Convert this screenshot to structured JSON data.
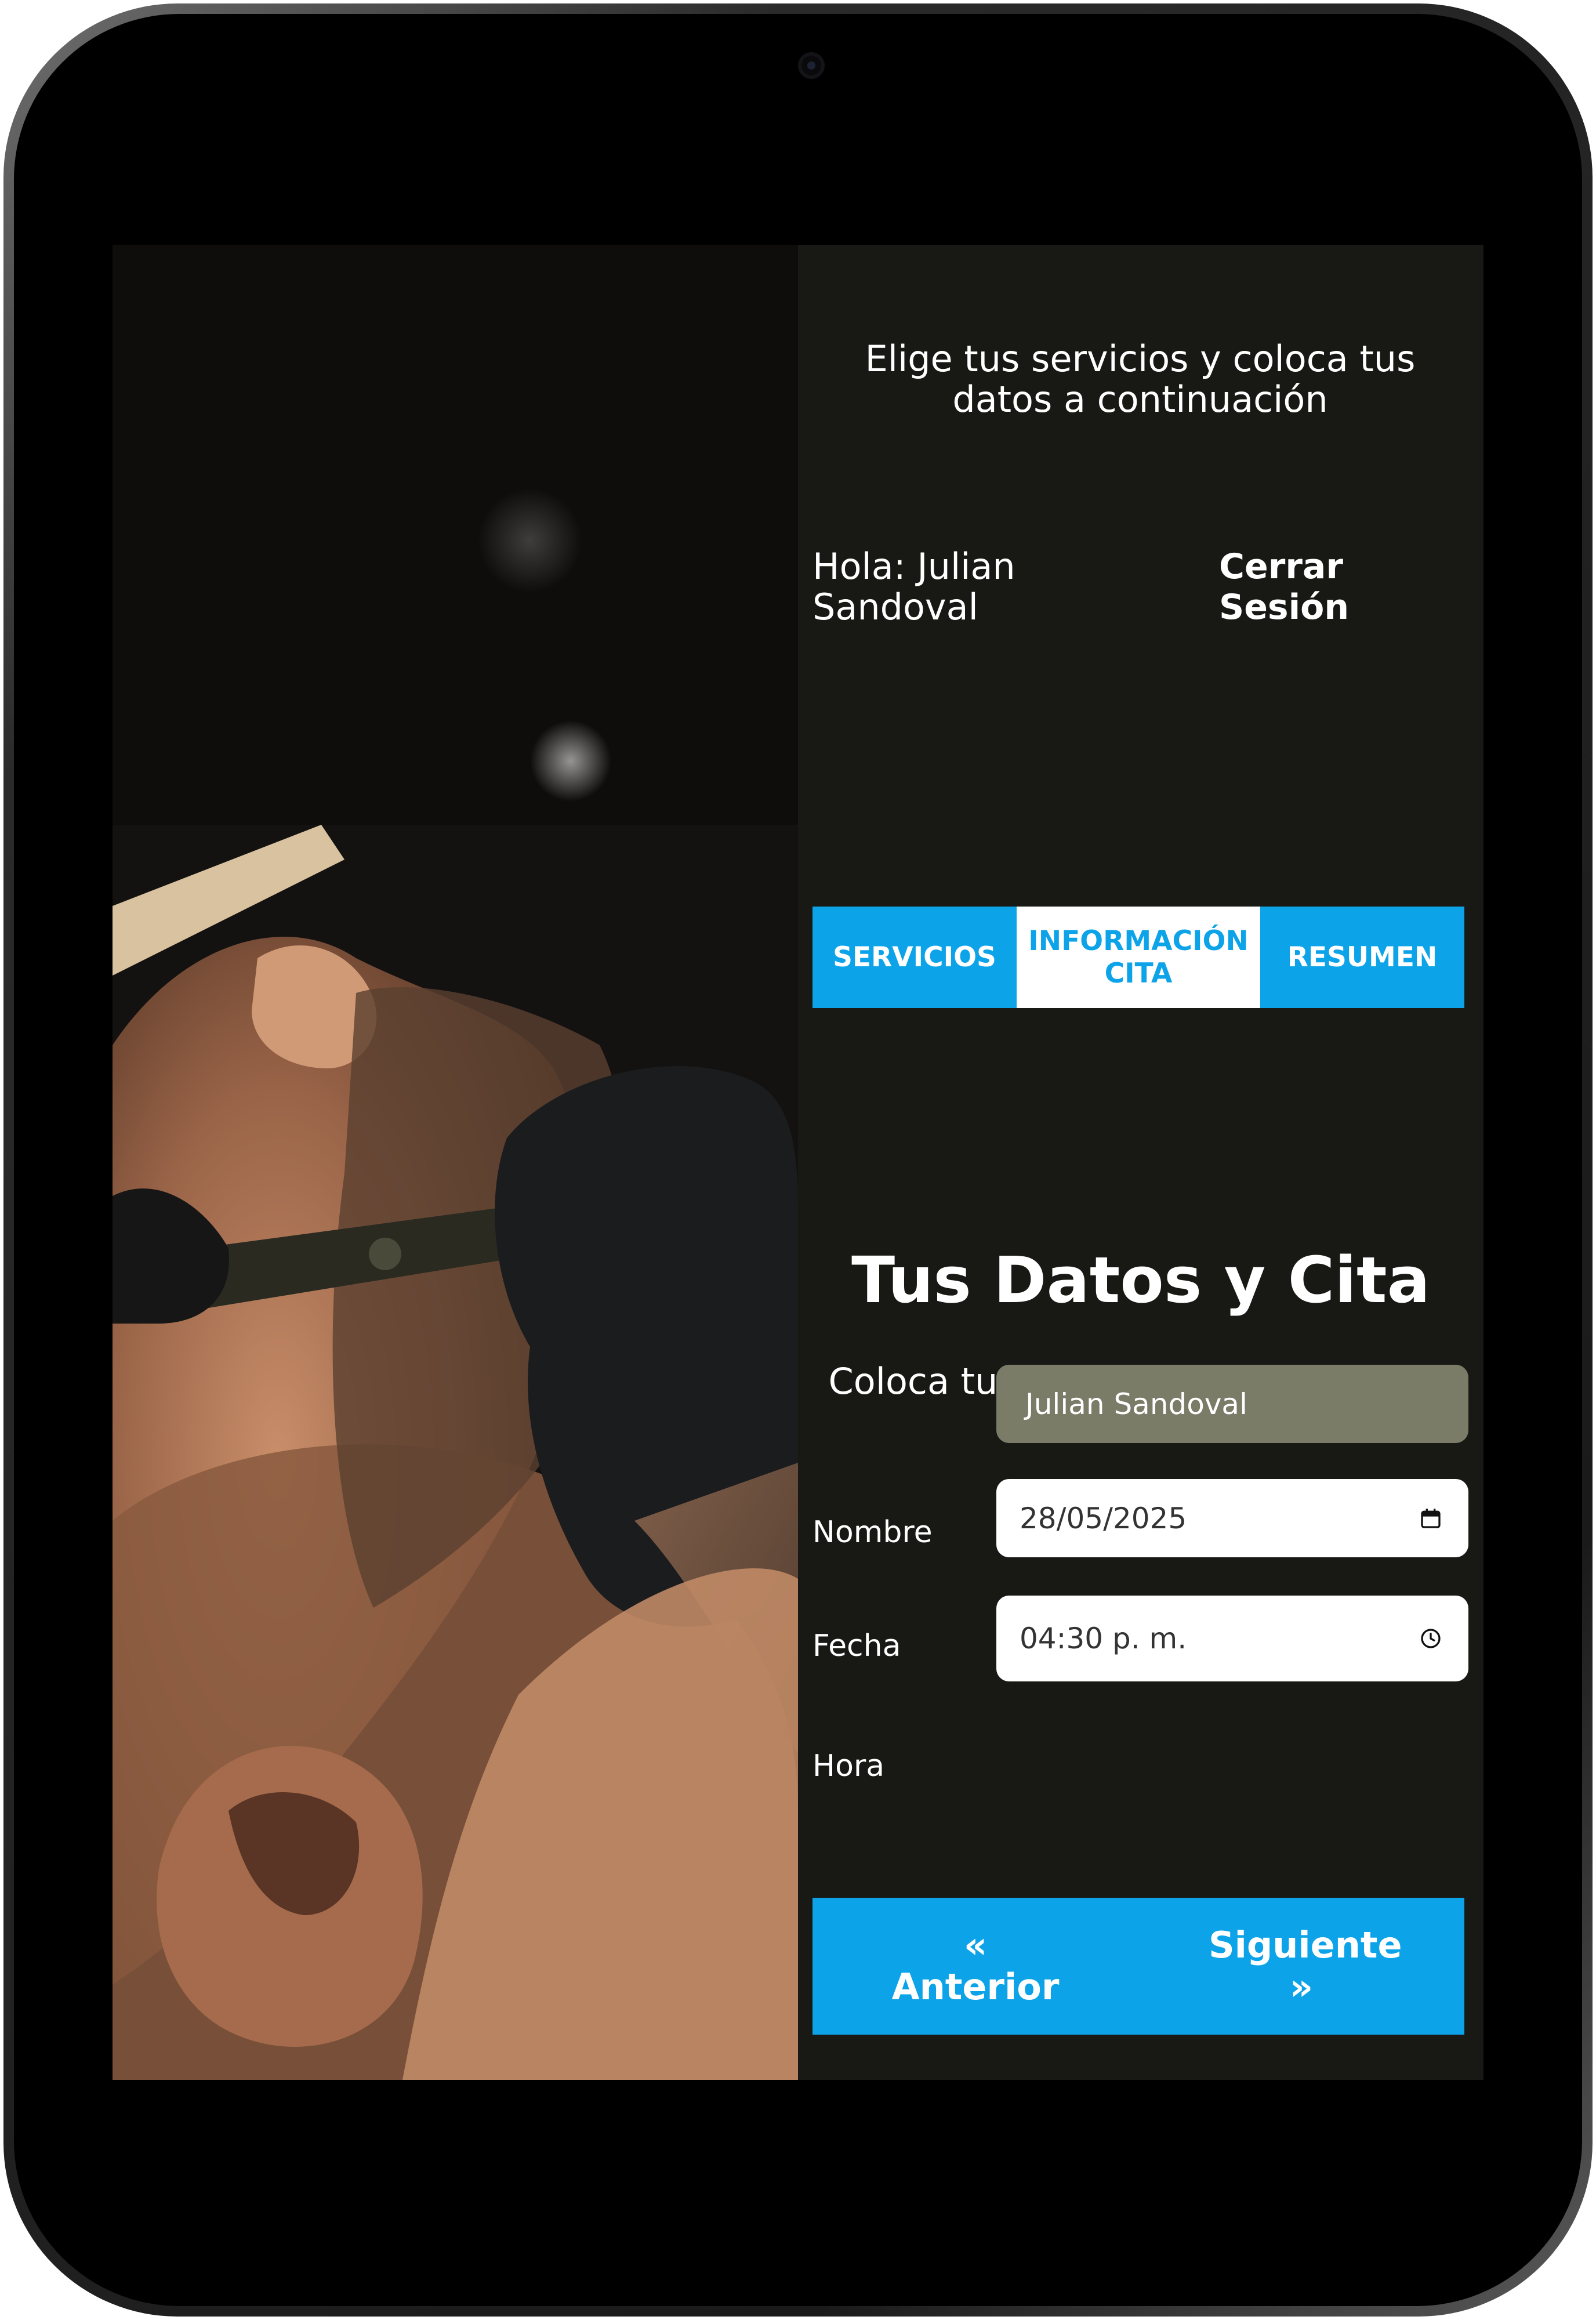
{
  "intro": "Elige tus servicios y coloca tus datos a continuación",
  "greeting": "Hola: Julian Sandoval",
  "logout_label": "Cerrar Sesión",
  "tabs": [
    {
      "label": "SERVICIOS"
    },
    {
      "label": "INFORMACIÓN CITA"
    },
    {
      "label": "RESUMEN"
    }
  ],
  "section": {
    "title": "Tus Datos y Cita",
    "subtitle": "Coloca tus datos y fecha de tu cita"
  },
  "form": {
    "name_label": "Nombre",
    "name_value": "Julian Sandoval",
    "date_label": "Fecha",
    "date_value": "28/05/2025",
    "time_label": "Hora",
    "time_value": "04:30 p. m."
  },
  "nav": {
    "prev_label": "« Anterior",
    "next_label": "Siguiente »"
  },
  "colors": {
    "accent": "#0da3e9",
    "panel_bg": "#181814",
    "name_field_bg": "#7a7c68"
  },
  "icons": {
    "date": "calendar-icon",
    "time": "clock-icon"
  }
}
